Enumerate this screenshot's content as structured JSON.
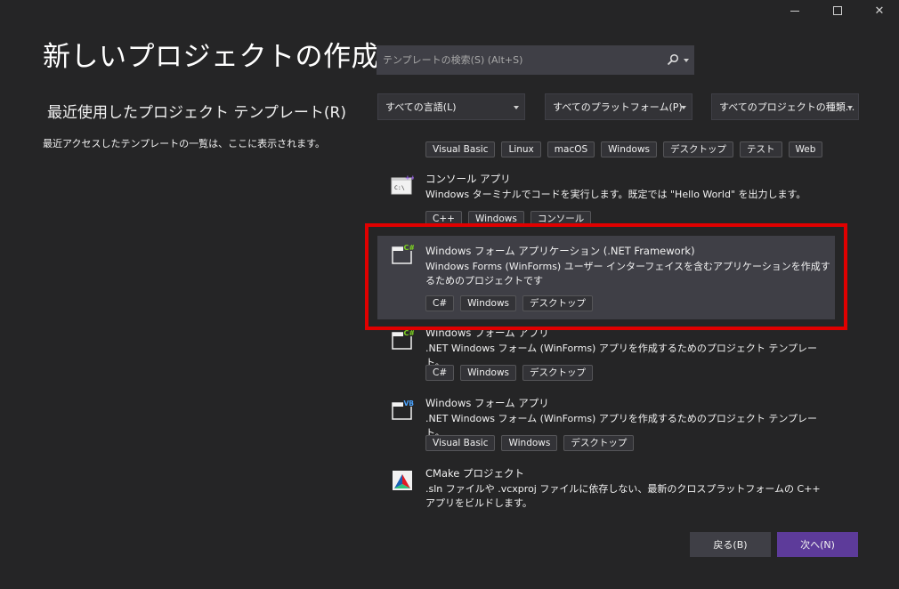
{
  "window": {
    "minimize_icon": "minimize-icon",
    "maximize_icon": "maximize-icon",
    "close_icon": "close-icon",
    "close_glyph": "✕"
  },
  "header": {
    "title": "新しいプロジェクトの作成"
  },
  "recent": {
    "heading": "最近使用したプロジェクト テンプレート(R)",
    "description": "最近アクセスしたテンプレートの一覧は、ここに表示されます。"
  },
  "search": {
    "placeholder": "テンプレートの検索(S) (Alt+S)",
    "value": ""
  },
  "filters": {
    "language": "すべての言語(L)",
    "platform": "すべてのプラットフォーム(P)",
    "project_type": "すべてのプロジェクトの種類..."
  },
  "top_tags": [
    "Visual Basic",
    "Linux",
    "macOS",
    "Windows",
    "デスクトップ",
    "テスト",
    "Web"
  ],
  "templates": [
    {
      "title": "コンソール アプリ",
      "description": "Windows ターミナルでコードを実行します。既定では \"Hello World\" を出力します。",
      "tags": [
        "C++",
        "Windows",
        "コンソール"
      ],
      "icon": "console-app-cpp-icon",
      "icon_text": "C:\\",
      "badge": "++"
    },
    {
      "title": "Windows フォーム アプリケーション (.NET Framework)",
      "description": "Windows Forms (WinForms) ユーザー インターフェイスを含むアプリケーションを作成するためのプロジェクトです",
      "tags": [
        "C#",
        "Windows",
        "デスクトップ"
      ],
      "icon": "winforms-csharp-icon",
      "badge": "C#",
      "selected": true
    },
    {
      "title": "Windows フォーム アプリ",
      "description": ".NET Windows フォーム (WinForms) アプリを作成するためのプロジェクト テンプレート。",
      "tags": [
        "C#",
        "Windows",
        "デスクトップ"
      ],
      "icon": "winforms-csharp-icon",
      "badge": "C#"
    },
    {
      "title": "Windows フォーム アプリ",
      "description": ".NET Windows フォーム (WinForms) アプリを作成するためのプロジェクト テンプレート。",
      "tags": [
        "Visual Basic",
        "Windows",
        "デスクトップ"
      ],
      "icon": "winforms-vb-icon",
      "badge": "VB"
    },
    {
      "title": "CMake プロジェクト",
      "description": ".sln ファイルや .vcxproj ファイルに依存しない、最新のクロスプラットフォームの C++ アプリをビルドします。",
      "tags": [],
      "icon": "cmake-icon"
    }
  ],
  "buttons": {
    "back": "戻る(B)",
    "next": "次へ(N)"
  },
  "colors": {
    "background": "#252526",
    "selected_item": "#3f3f46",
    "highlight_border": "#e00000",
    "primary_button": "#5d3b9a"
  }
}
